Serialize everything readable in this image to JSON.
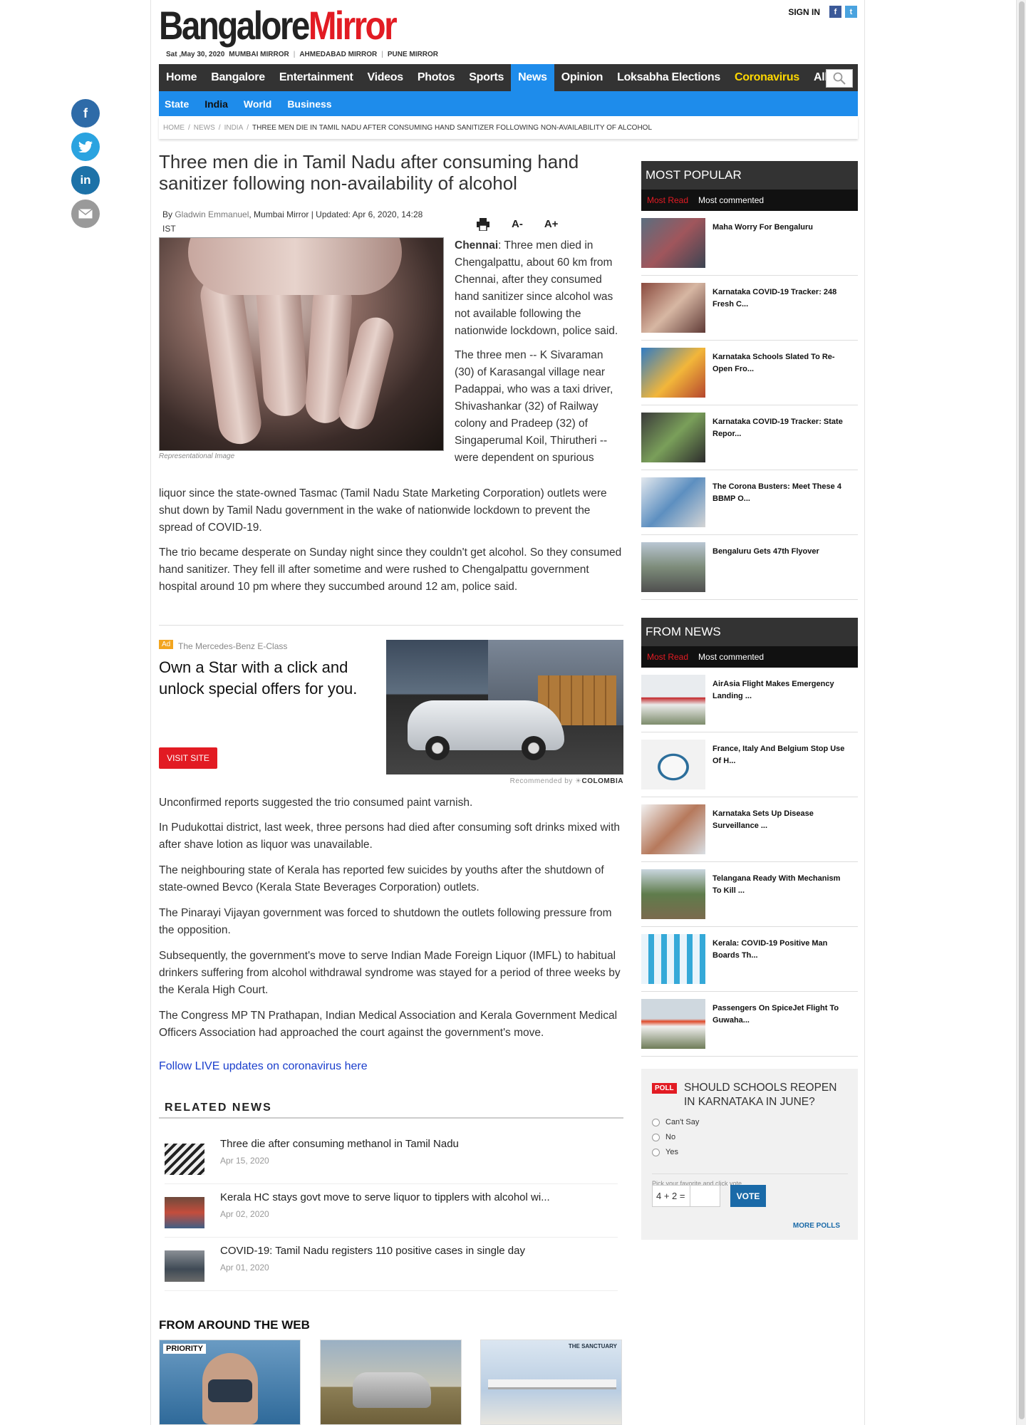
{
  "brand": {
    "part1": "Bangalore",
    "part2": "Mirror"
  },
  "dateline": {
    "date": "Sat ,May 30, 2020",
    "links": [
      "MUMBAI MIRROR",
      "AHMEDABAD MIRROR",
      "PUNE MIRROR"
    ]
  },
  "header": {
    "signin": "SIGN IN",
    "fb": "f",
    "tw": "t"
  },
  "nav": {
    "items": [
      "Home",
      "Bangalore",
      "Entertainment",
      "Videos",
      "Photos",
      "Sports",
      "News",
      "Opinion",
      "Loksabha Elections",
      "Coronavirus",
      "All"
    ],
    "active": "News"
  },
  "subnav": {
    "items": [
      "State",
      "India",
      "World",
      "Business"
    ],
    "active": "India"
  },
  "breadcrumb": [
    "HOME",
    "NEWS",
    "INDIA",
    "THREE MEN DIE IN TAMIL NADU AFTER CONSUMING HAND SANITIZER FOLLOWING NON-AVAILABILITY OF ALCOHOL"
  ],
  "article": {
    "headline": "Three men die in Tamil Nadu after consuming hand sanitizer following non-availability of alcohol",
    "by": "By ",
    "author": "Gladwin Emmanuel",
    "source": ", Mumbai Mirror | Updated: Apr 6, 2020, 14:28 IST",
    "tool_small": "A-",
    "tool_large": "A+",
    "caption": "Representational Image",
    "lead_city": "Chennai",
    "lead_rest": ": Three men died in Chengalpattu, about 60 km from Chennai, after they consumed hand sanitizer since alcohol was not available following the nationwide lockdown, police said.",
    "p2a": "The three men -- K Sivaraman (30) of Karasangal village near Padappai, who was a taxi driver, Shivashankar (32) of Railway colony and Pradeep (32) of Singaperumal Koil, Thirutheri -- were dependent on spurious",
    "p2b": "liquor since the state-owned Tasmac (Tamil Nadu State Marketing Corporation) outlets were shut down by Tamil Nadu government in the wake of nationwide lockdown to prevent the spread of COVID-19.",
    "p3": "The trio became desperate on Sunday night since they couldn't get alcohol. So they consumed hand sanitizer. They fell ill after sometime and were rushed to Chengalpattu government hospital around 10 pm where they succumbed around 12 am, police said.",
    "p4": "Unconfirmed reports suggested the trio consumed paint varnish.",
    "p5": "In Pudukottai district, last week, three persons had died after consuming soft drinks mixed with after shave lotion as liquor was unavailable.",
    "p6": "The neighbouring state of Kerala has reported few suicides by youths after the shutdown of state-owned Bevco (Kerala State Beverages Corporation) outlets.",
    "p7": "The Pinarayi Vijayan government was forced to shutdown the outlets following pressure from the opposition.",
    "p8": "Subsequently, the government's move to serve Indian Made Foreign Liquor (IMFL) to habitual drinkers suffering from alcohol withdrawal syndrome was stayed for a period of three weeks by the Kerala High Court.",
    "p9": "The Congress MP TN Prathapan, Indian Medical Association and Kerala Government Medical Officers Association had approached the court against the government's move.",
    "live_link": "Follow LIVE updates on coronavirus here"
  },
  "ad": {
    "tag": "Ad",
    "brand": "The Mercedes-Benz E-Class",
    "title": "Own a Star with a click and unlock special offers for you.",
    "cta": "VISIT SITE",
    "recommended": "Recommended by",
    "network": "COLOMBIA"
  },
  "related": {
    "heading": "RELATED NEWS",
    "items": [
      {
        "title": "Three die after consuming methanol in Tamil Nadu",
        "date": "Apr 15, 2020"
      },
      {
        "title": "Kerala HC stays govt move to serve liquor to tipplers with alcohol wi...",
        "date": "Apr 02, 2020"
      },
      {
        "title": "COVID-19: Tamil Nadu registers 110 positive cases in single day",
        "date": "Apr 01, 2020"
      }
    ]
  },
  "around": {
    "heading": "FROM AROUND THE WEB",
    "card1_badge": "PRIORITY",
    "card3_badge": "THE SANCTUARY"
  },
  "popular": {
    "heading": "MOST POPULAR",
    "tab_active": "Most Read",
    "tab_other": "Most commented",
    "items": [
      "Maha Worry For Bengaluru",
      "Karnataka COVID-19 Tracker: 248 Fresh C...",
      "Karnataka Schools Slated To Re-Open Fro...",
      "Karnataka COVID-19 Tracker: State Repor...",
      "The Corona Busters: Meet These 4 BBMP O...",
      "Bengaluru Gets 47th Flyover"
    ]
  },
  "fromnews": {
    "heading": "FROM NEWS",
    "tab_active": "Most Read",
    "tab_other": "Most commented",
    "items": [
      "AirAsia Flight Makes Emergency Landing ...",
      "France, Italy And Belgium Stop Use Of H...",
      "Karnataka Sets Up Disease Surveillance ...",
      "Telangana Ready With Mechanism To Kill ...",
      "Kerala: COVID-19 Positive Man Boards Th...",
      "Passengers On SpiceJet Flight To Guwaha..."
    ]
  },
  "poll": {
    "tag": "POLL",
    "question": "SHOULD SCHOOLS REOPEN IN KARNATAKA IN JUNE?",
    "options": [
      "Can't Say",
      "No",
      "Yes"
    ],
    "hint": "Pick your favorite and click vote",
    "captcha": "4 + 2 =",
    "vote": "VOTE",
    "more": "MORE POLLS"
  }
}
